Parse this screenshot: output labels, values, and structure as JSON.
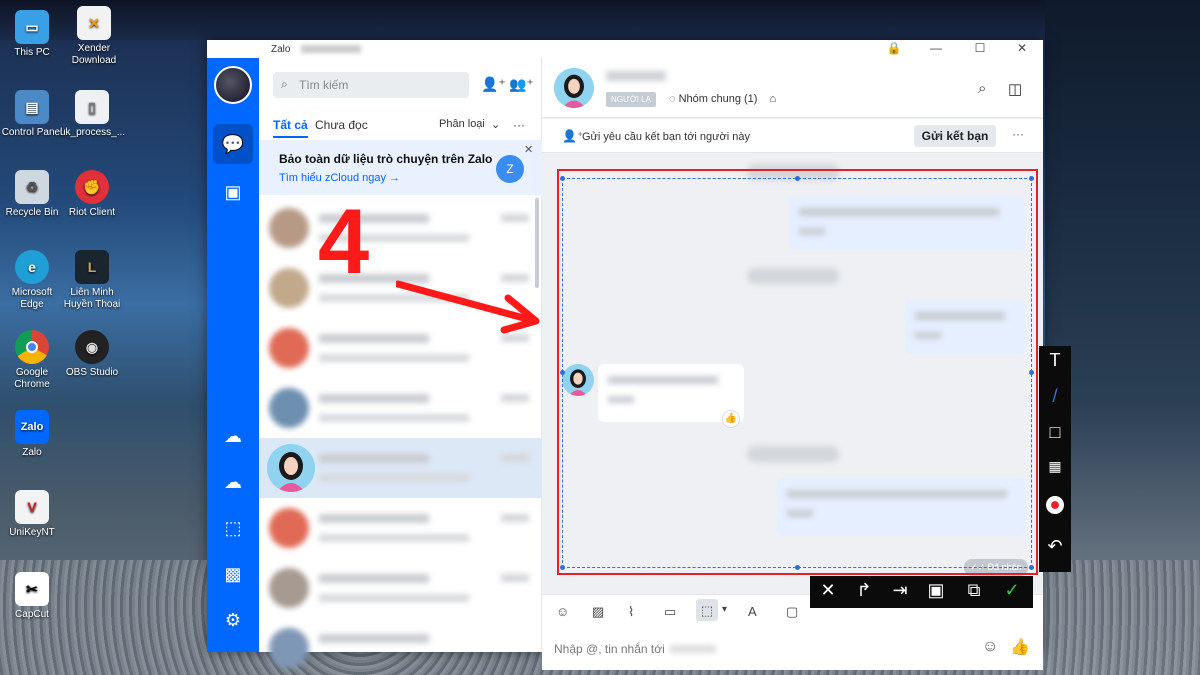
{
  "desktop": {
    "icons": [
      {
        "label": "This PC",
        "icon": "monitor-icon"
      },
      {
        "label": "Xender Download",
        "icon": "xender-icon"
      },
      {
        "label": "Control Panel",
        "icon": "control-panel-icon"
      },
      {
        "label": "uk_process_...",
        "icon": "file-icon"
      },
      {
        "label": "Recycle Bin",
        "icon": "recycle-bin-icon"
      },
      {
        "label": "Riot Client",
        "icon": "riot-icon"
      },
      {
        "label": "Microsoft Edge",
        "icon": "edge-icon"
      },
      {
        "label": "Liên Minh Huyền Thoại",
        "icon": "league-icon"
      },
      {
        "label": "Google Chrome",
        "icon": "chrome-icon"
      },
      {
        "label": "OBS Studio",
        "icon": "obs-icon"
      },
      {
        "label": "Zalo",
        "icon": "zalo-icon"
      },
      {
        "label": "UniKeyNT",
        "icon": "unikey-icon"
      },
      {
        "label": "CapCut",
        "icon": "capcut-icon"
      }
    ]
  },
  "window": {
    "title": "Zalo",
    "controls": [
      "🔒",
      "—",
      "☐",
      "✕"
    ]
  },
  "list": {
    "search_placeholder": "Tìm kiếm",
    "tab_all": "Tất cả",
    "tab_unread": "Chưa đọc",
    "tab_classify": "Phân loại",
    "tab_more": "···",
    "banner_title": "Bảo toàn dữ liệu trò chuyện trên Zalo",
    "banner_link": "Tìm hiểu zCloud ngay →",
    "banner_close": "✕"
  },
  "pane": {
    "badge": "NGƯỜI LẠ",
    "group": "Nhóm chung (1)",
    "friend_request_text": "Gửi yêu cầu kết bạn tới người này",
    "friend_button": "Gửi kết bạn",
    "friend_more": "···",
    "seen": "Đã nhận",
    "compose_placeholder": "Nhập @, tin nhắn tới"
  },
  "annotation": {
    "step_number": "4"
  },
  "colors": {
    "zalo_blue": "#0068ff",
    "annotation_red": "#ff1a1a",
    "selection_blue": "#2f6fd9"
  }
}
